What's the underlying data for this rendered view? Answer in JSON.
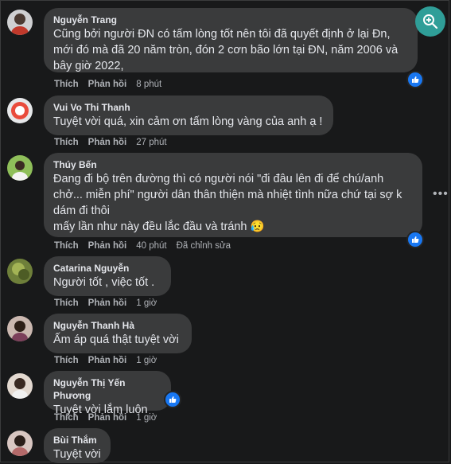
{
  "toolbar": {
    "zoom_icon": "zoom-in-icon"
  },
  "comments": [
    {
      "author": "Nguyễn Trang",
      "text": "Cũng bởi người ĐN có tấm lòng tốt nên tôi đã quyết định ở lại Đn,\nmới đó mà đã 20 năm tròn, đón 2 cơn bão lớn tại ĐN, năm 2006 và\nbây giờ 2022,",
      "like": "Thích",
      "reply": "Phản hồi",
      "time": "8 phút"
    },
    {
      "author": "Vui Vo Thi Thanh",
      "text": "Tuyệt vời quá, xin cảm ơn tấm lòng vàng của anh ạ !",
      "like": "Thích",
      "reply": "Phản hồi",
      "time": "27 phút"
    },
    {
      "author": "Thúy Bến",
      "text": "Đang đi bộ trên đường thì có người nói \"đi đâu lên đi để chú/anh\nchở... miễn phí\" người dân thân thiện mà nhiệt tình nữa chứ tại sợ k\ndám đi thôi\nmấy lần như này đều lắc đầu và tránh 😥",
      "like": "Thích",
      "reply": "Phản hồi",
      "time": "40 phút",
      "edited": "Đã chỉnh sửa"
    },
    {
      "author": "Catarina Nguyễn",
      "text": "Người tốt , việc tốt .",
      "like": "Thích",
      "reply": "Phản hồi",
      "time": "1 giờ"
    },
    {
      "author": "Nguyễn Thanh Hà",
      "text": "Ấm áp quá thật tuyệt vời",
      "like": "Thích",
      "reply": "Phản hồi",
      "time": "1 giờ"
    },
    {
      "author": "Nguyễn Thị Yến Phương",
      "text": "Tuyệt vời lắm luôn",
      "like": "Thích",
      "reply": "Phản hồi",
      "time": "1 giờ"
    },
    {
      "author": "Bùi Thắm",
      "text": "Tuyệt vời"
    }
  ],
  "colors": {
    "accent": "#1877f2",
    "bubble": "#3a3b3c",
    "zoom": "#2f9e98"
  }
}
